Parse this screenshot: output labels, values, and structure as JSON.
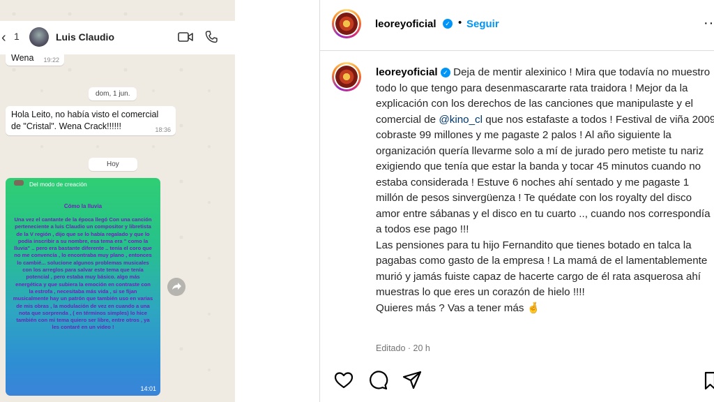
{
  "whatsapp": {
    "header": {
      "back_icon": "chevron-left-icon",
      "back_symbol": "‹",
      "unread_count": "1",
      "contact_name": "Luis Claudio",
      "video_icon": "video-camera-icon",
      "phone_icon": "phone-icon"
    },
    "messages": [
      {
        "text": "Wena",
        "time": "19:22"
      },
      {
        "date_pill": "dom, 1 jun."
      },
      {
        "text_line1": "Hola Leito, no había visto el comercial",
        "text_line2": "de \"Cristal\". Wena Crack!!!!!!",
        "time": "18:36"
      },
      {
        "date_pill": "Hoy"
      }
    ],
    "status_message": {
      "source_label": "Del modo de creación",
      "title": "Cómo la lluvia",
      "body": "Una vez el cantante de la época llegó Con una canción perteneciente a luis Claudio un compositor y libretista de la V región , dijo que se lo había regalado y que lo podía inscribir a su nombre, esa tema era \" como la lluvia\" .. pero era bastante diferente .. tenía el coro que no me convencía , lo encontraba muy plano , entonces lo cambié... solucione algunos problemas musicales con los arreglos para salvar este tema que tenía potencial , pero estaba muy básico. algo más energética y que subiera la emoción en contraste con la estrofa , necesitaba más vida , si se fijan musicalmente hay un patrón que también uso en varias de mis obras , la modulación de vez en cuando a una nota que sorprenda , ( en términos simples) lo hice también con mi tema quiero ser libre, entre otros , ya les contaré en un video !",
      "time": "14:01",
      "forward_icon": "forward-arrow-icon"
    }
  },
  "instagram": {
    "header": {
      "username": "leoreyoficial",
      "verified_icon": "verified-badge-icon",
      "separator": "•",
      "follow_label": "Seguir"
    },
    "caption": {
      "username": "leoreyoficial",
      "part1": " Deja de mentir alexinico ! Mira que todavía no muestro todo lo que tengo para desenmascararte rata traidora ! Mejor da la explicación con los derechos de las canciones que manipulaste y el comercial de ",
      "mention": "@kino_cl",
      "part2": " que nos estafaste a todos ! Festival de viña 2009 cobraste 99 millones y me pagaste 2 palos ! Al año siguiente la organización quería llevarme solo a mí de jurado pero metiste tu nariz exigiendo que tenía que estar la banda y tocar 45 minutos cuando no estaba considerada ! Estuve 6 noches ahí sentado y me pagaste 1 millón de pesos sinvergüenza ! Te quédate con los royalty del disco amor entre sábanas y el disco en tu cuarto .., cuando nos correspondía a todos ese pago !!!",
      "part3": "Las pensiones para tu hijo Fernandito que tienes botado en talca la pagabas como gasto de la empresa ! La mamá de el lamentablemente murió y jamás fuiste capaz de hacerte cargo de él rata asquerosa ahí muestras lo que eres un corazón de hielo !!!!",
      "part4": "Quieres más ? Vas a tener más 🤞"
    },
    "meta": "Editado · 20 h",
    "actions": [
      "heart-icon",
      "comment-icon",
      "share-icon",
      "save-icon"
    ]
  }
}
